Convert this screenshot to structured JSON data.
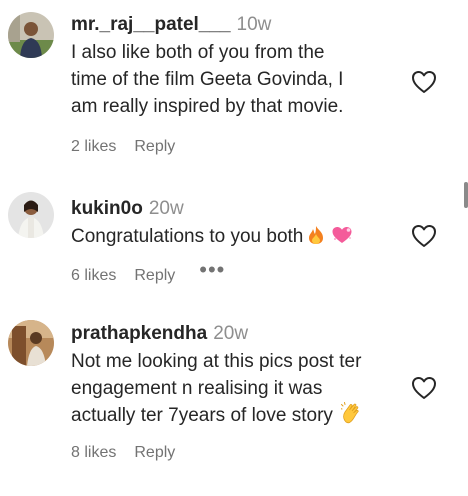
{
  "comments": [
    {
      "username": "mr._raj__patel___",
      "time": "10w",
      "text": "I also like both of you from the\ntime of the film Geeta Govinda, I\nam really inspired by that movie.",
      "likes": "2 likes",
      "reply": "Reply",
      "avatar_icon": "avatar-photo"
    },
    {
      "username": "kukin0o",
      "time": "20w",
      "text": "Congratulations to you both",
      "emojis": [
        "fire-emoji",
        "pink-heart-emoji"
      ],
      "likes": "6 likes",
      "reply": "Reply",
      "more": "•••",
      "avatar_icon": "avatar-photo"
    },
    {
      "username": "prathapkendha",
      "time": "20w",
      "text": "Not me looking at this pics post ter\nengagement n realising it was\nactually ter 7years of love story",
      "emojis": [
        "clapping-hands-emoji"
      ],
      "likes": "8 likes",
      "reply": "Reply",
      "avatar_icon": "avatar-photo"
    }
  ],
  "colors": {
    "primary_text": "#262626",
    "secondary_text": "#737373",
    "heart_outline": "#262626"
  },
  "icons": {
    "like": "heart-outline-icon"
  }
}
